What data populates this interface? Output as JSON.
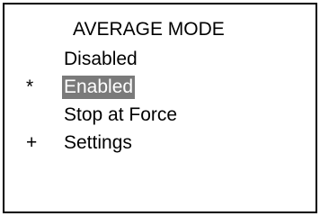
{
  "screen": {
    "title": "AVERAGE MODE"
  },
  "menu": {
    "items": [
      {
        "marker": "",
        "label": "Disabled",
        "selected": false
      },
      {
        "marker": "*",
        "label": "Enabled",
        "selected": true
      },
      {
        "marker": "",
        "label": "Stop at Force",
        "selected": false
      },
      {
        "marker": "+",
        "label": "Settings",
        "selected": false
      }
    ]
  },
  "colors": {
    "highlight_background": "#7a7a7a",
    "highlight_text": "#ffffff",
    "text": "#000000",
    "border": "#000000",
    "background": "#ffffff"
  }
}
